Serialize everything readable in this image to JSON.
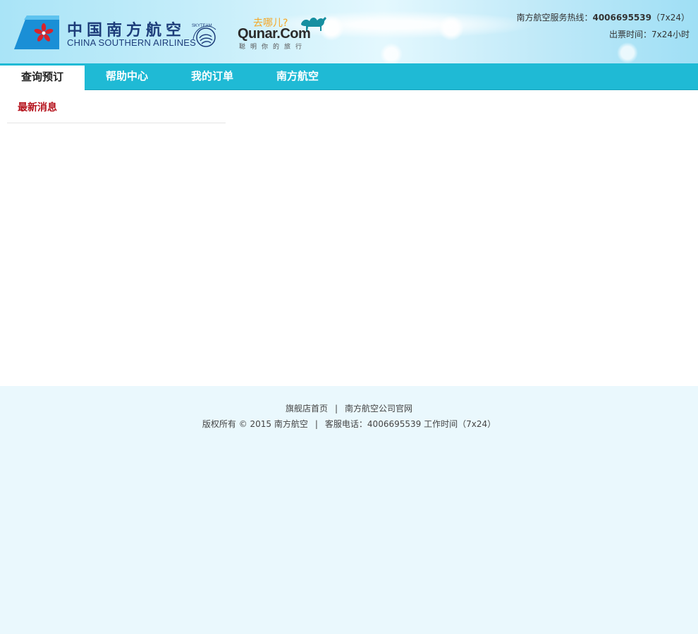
{
  "header": {
    "brand_cn": "中国南方航空",
    "brand_en": "CHINA SOUTHERN AIRLINES",
    "skyteam": "SKYTEAM",
    "qunar_tag": "去哪儿?",
    "qunar_word": "Qunar.Com",
    "qunar_slogan": "聪明你的旅行",
    "hotline_label": "南方航空服务热线：",
    "hotline_number": "4006695539",
    "hotline_hours": "（7x24）",
    "ticket_hours": "出票时间：7x24小时"
  },
  "nav": {
    "items": [
      {
        "label": "查询预订",
        "active": true
      },
      {
        "label": "帮助中心",
        "active": false
      },
      {
        "label": "我的订单",
        "active": false
      },
      {
        "label": "南方航空",
        "active": false
      }
    ]
  },
  "main": {
    "news_title": "最新消息"
  },
  "footer": {
    "link_home": "旗舰店首页",
    "link_sep": "|",
    "link_official": "南方航空公司官网",
    "copyright": "版权所有 © 2015 南方航空",
    "copy_sep": "|",
    "service": "客服电话：4006695539 工作时间（7x24）"
  },
  "colors": {
    "nav_bg": "#1fbad5",
    "brand_blue": "#1d3d7a",
    "news_red": "#b5111b",
    "qunar_orange": "#f5a623"
  }
}
